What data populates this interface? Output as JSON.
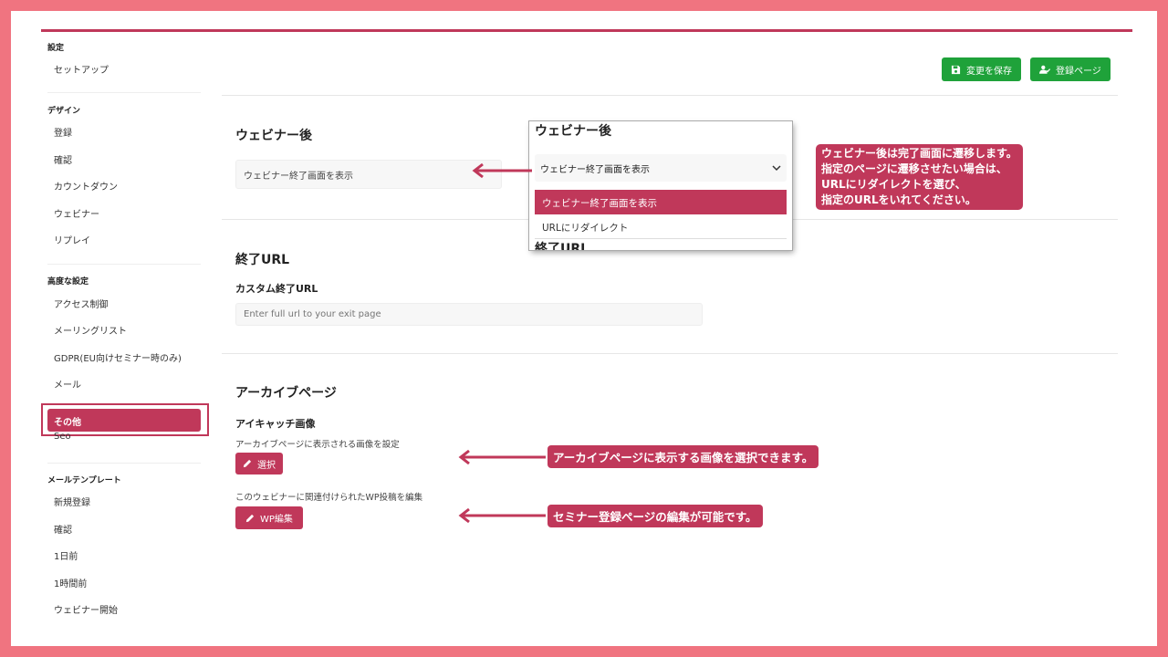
{
  "sidebar": {
    "sections": [
      {
        "title": "設定",
        "items": [
          "セットアップ"
        ]
      },
      {
        "title": "デザイン",
        "items": [
          "登録",
          "確認",
          "カウントダウン",
          "ウェビナー",
          "リプレイ"
        ]
      },
      {
        "title": "高度な設定",
        "items": [
          "アクセス制御",
          "メーリングリスト",
          "GDPR(EU向けセミナー時のみ)",
          "メール",
          "その他",
          "Seo"
        ]
      },
      {
        "title": "メールテンプレート",
        "items": [
          "新規登録",
          "確認",
          "1日前",
          "1時間前",
          "ウェビナー開始"
        ]
      }
    ],
    "active": "その他"
  },
  "toolbar": {
    "save_label": "変更を保存",
    "register_label": "登録ページ"
  },
  "after_webinar": {
    "title": "ウェビナー後",
    "select_value": "ウェビナー終了画面を表示"
  },
  "popup": {
    "title": "ウェビナー後",
    "select_value": "ウェビナー終了画面を表示",
    "options": [
      "ウェビナー終了画面を表示",
      "URLにリダイレクト"
    ],
    "overlap_title": "終了URL"
  },
  "exit_url": {
    "title": "終了URL",
    "label": "カスタム終了URL",
    "placeholder": "Enter full url to your exit page"
  },
  "archive": {
    "title": "アーカイブページ",
    "eyecatch_label": "アイキャッチ画像",
    "eyecatch_desc": "アーカイブページに表示される画像を設定",
    "select_button": "選択",
    "wp_desc": "このウェビナーに関連付けられたWP投稿を編集",
    "wp_button": "WP編集"
  },
  "callouts": {
    "after_webinar_lines": [
      "ウェビナー後は完了画面に遷移します。",
      "指定のページに遷移させたい場合は、",
      "URLにリダイレクトを選び、",
      "指定のURLをいれてください。"
    ],
    "archive_image": "アーカイブページに表示する画像を選択できます。",
    "wp_edit": "セミナー登録ページの編集が可能です。"
  },
  "colors": {
    "background": "#f07480",
    "accent": "#c0385a",
    "green": "#1fa23a"
  }
}
